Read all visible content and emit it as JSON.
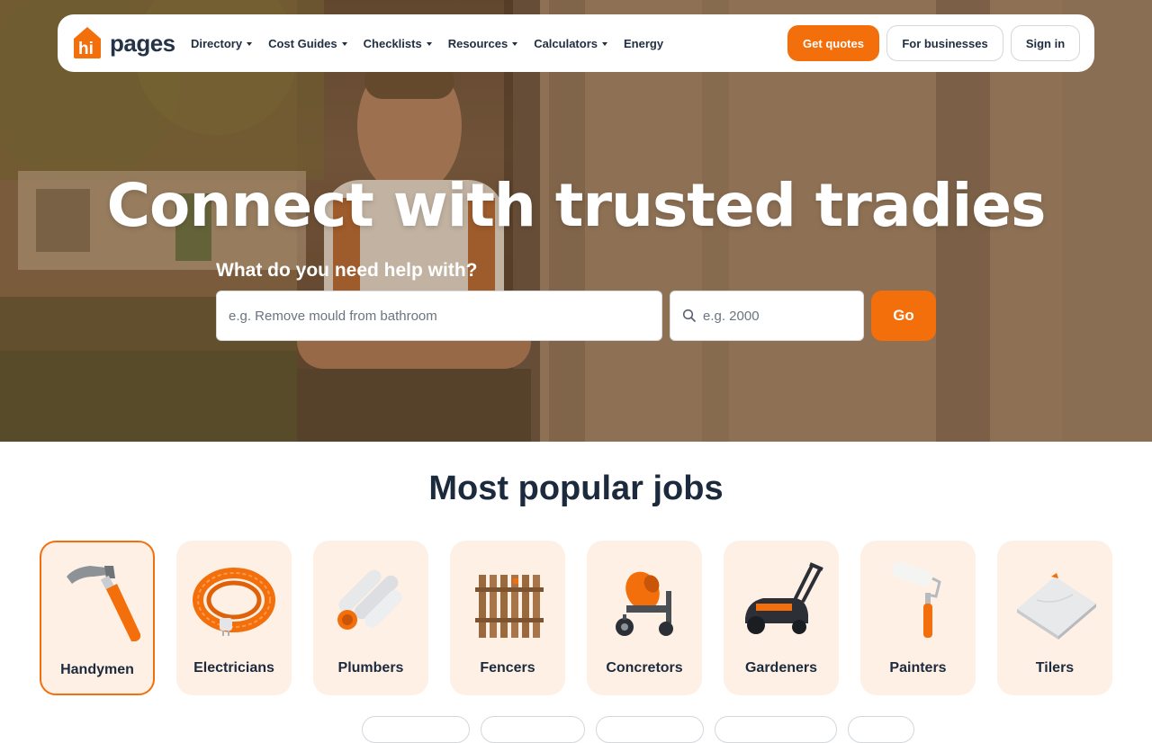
{
  "brand": {
    "name": "pages",
    "accent": "#f26f0b",
    "dark": "#1c2a3d"
  },
  "nav": {
    "items": [
      {
        "label": "Directory",
        "has_dropdown": true
      },
      {
        "label": "Cost Guides",
        "has_dropdown": true
      },
      {
        "label": "Checklists",
        "has_dropdown": true
      },
      {
        "label": "Resources",
        "has_dropdown": true
      },
      {
        "label": "Calculators",
        "has_dropdown": true
      },
      {
        "label": "Energy",
        "has_dropdown": false
      }
    ],
    "get_quotes_label": "Get quotes",
    "for_businesses_label": "For businesses",
    "sign_in_label": "Sign in"
  },
  "hero": {
    "title": "Connect with trusted tradies",
    "search_label": "What do you need help with?",
    "job_placeholder": "e.g. Remove mould from bathroom",
    "postcode_placeholder": "e.g. 2000",
    "go_label": "Go"
  },
  "popular": {
    "title": "Most popular jobs",
    "jobs": [
      {
        "label": "Handymen",
        "icon": "hammer-icon",
        "selected": true
      },
      {
        "label": "Electricians",
        "icon": "cable-coil-icon",
        "selected": false
      },
      {
        "label": "Plumbers",
        "icon": "pipes-icon",
        "selected": false
      },
      {
        "label": "Fencers",
        "icon": "fence-icon",
        "selected": false
      },
      {
        "label": "Concretors",
        "icon": "cement-mixer-icon",
        "selected": false
      },
      {
        "label": "Gardeners",
        "icon": "lawn-mower-icon",
        "selected": false
      },
      {
        "label": "Painters",
        "icon": "paint-roller-icon",
        "selected": false
      },
      {
        "label": "Tilers",
        "icon": "tile-icon",
        "selected": false
      }
    ]
  }
}
